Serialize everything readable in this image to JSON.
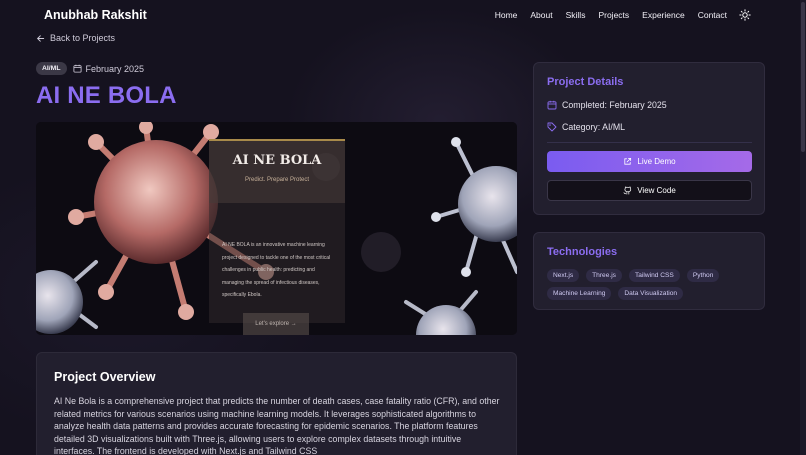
{
  "header": {
    "brand": "Anubhab Rakshit",
    "nav": [
      "Home",
      "About",
      "Skills",
      "Projects",
      "Experience",
      "Contact"
    ]
  },
  "back_link": "Back to Projects",
  "project": {
    "category_tag": "AI/ML",
    "date": "February 2025",
    "title": "AI NE BOLA"
  },
  "hero": {
    "title": "AI NE BOLA",
    "subtitle": "Predict. Prepare Protect",
    "description": "AI NE BOLA is an innovative machine learning project designed to tackle one of the most critical challenges in public health: predicting and managing the spread of infectious diseases, specifically Ebola.",
    "button": "Let's explore →"
  },
  "overview": {
    "heading": "Project Overview",
    "text": "AI Ne Bola is a comprehensive project that predicts the number of death cases, case fatality ratio (CFR), and other related metrics for various scenarios using machine learning models. It leverages sophisticated algorithms to analyze health data patterns and provides accurate forecasting for epidemic scenarios. The platform features detailed 3D visualizations built with Three.js, allowing users to explore complex datasets through intuitive interfaces. The frontend is developed with Next.js and Tailwind CSS"
  },
  "details": {
    "heading": "Project Details",
    "completed": "Completed: February 2025",
    "category": "Category: AI/ML",
    "live_demo": "Live Demo",
    "view_code": "View Code"
  },
  "tech": {
    "heading": "Technologies",
    "items": [
      "Next.js",
      "Three.js",
      "Tailwind CSS",
      "Python",
      "Machine Learning",
      "Data Visualization"
    ]
  },
  "colors": {
    "accent": "#8b6df0",
    "background": "#15121f",
    "card": "#221f2e"
  }
}
